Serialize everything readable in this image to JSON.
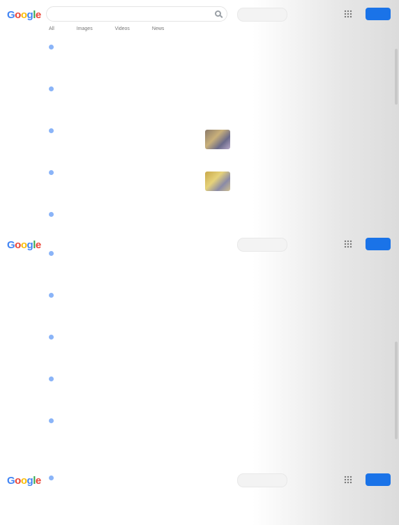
{
  "logo_letters": [
    "G",
    "o",
    "o",
    "g",
    "l",
    "e"
  ],
  "frames": [
    {
      "query": "",
      "tabs": [
        "All",
        "Images",
        "Videos",
        "News"
      ],
      "results": [
        {
          "cite": "",
          "title": "",
          "snippet": "",
          "thumb": false
        },
        {
          "cite": "",
          "title": "",
          "snippet": "",
          "thumb": false
        },
        {
          "cite": "",
          "title": "",
          "snippet": "",
          "thumb": true
        },
        {
          "cite": "",
          "title": "",
          "snippet": "",
          "thumb": true
        },
        {
          "cite": "",
          "title": "",
          "snippet": "",
          "thumb": false
        }
      ]
    },
    {
      "query": "",
      "results": [
        {
          "cite": "",
          "title": "",
          "snippet": "",
          "thumb": false
        },
        {
          "cite": "",
          "title": "",
          "snippet": "",
          "thumb": false
        },
        {
          "cite": "",
          "title": "",
          "snippet": "",
          "thumb": false
        },
        {
          "cite": "",
          "title": "",
          "snippet": "",
          "thumb": false
        },
        {
          "cite": "",
          "title": "",
          "snippet": "",
          "thumb": false
        }
      ]
    },
    {
      "query": "",
      "results": [
        {
          "cite": "",
          "title": "",
          "snippet": "",
          "thumb": false
        }
      ]
    }
  ],
  "colors": {
    "link": "#1a0dab",
    "accent": "#1a73e8"
  },
  "icons": {
    "apps": "grid-icon",
    "search": "search-icon"
  }
}
